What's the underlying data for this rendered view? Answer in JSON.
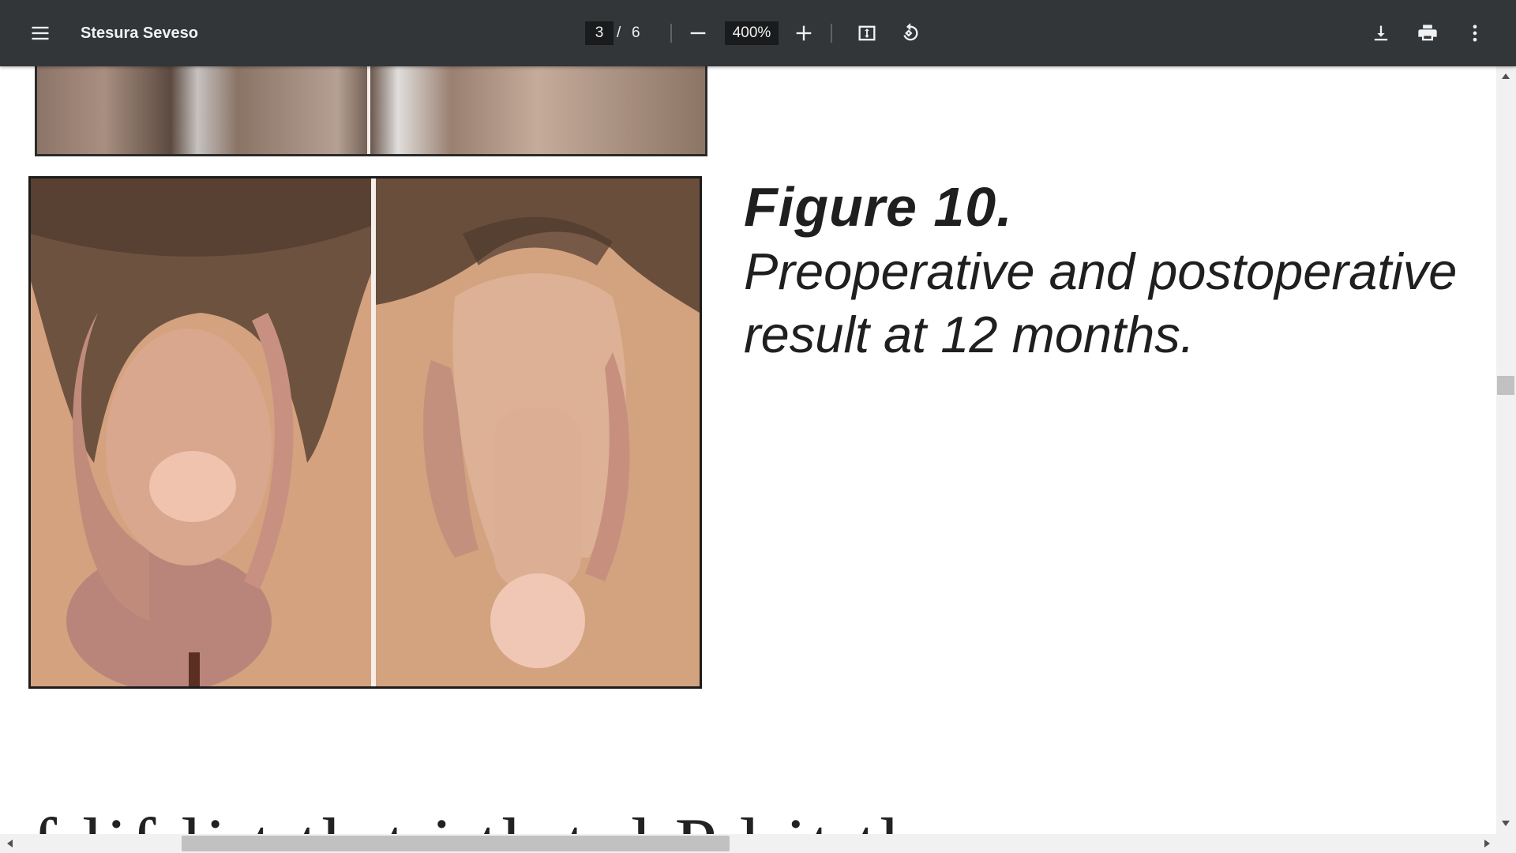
{
  "toolbar": {
    "menu_icon": "menu-icon",
    "title": "Stesura Seveso",
    "current_page": "3",
    "page_separator": "/",
    "total_pages": "6",
    "zoom_out_icon": "minus-icon",
    "zoom_level": "400%",
    "zoom_in_icon": "plus-icon",
    "fit_page_icon": "fit-to-page-icon",
    "rotate_icon": "rotate-counterclockwise-icon",
    "download_icon": "download-icon",
    "print_icon": "print-icon",
    "more_icon": "more-vert-icon"
  },
  "document": {
    "figure_title": "Figure 10.",
    "figure_caption_line1": "Preoperative and postoperative",
    "figure_caption_line2": "result at 12 months.",
    "cut_off_text": "f    lif       li           t   th  t   i   th                      t   d    P  l       it  th"
  },
  "colors": {
    "toolbar_bg": "#323639",
    "toolbar_text": "#f1f1f1",
    "viewer_bg": "#ffffff",
    "scrollbar_track": "#f1f1f1",
    "scrollbar_thumb": "#c1c1c1"
  }
}
